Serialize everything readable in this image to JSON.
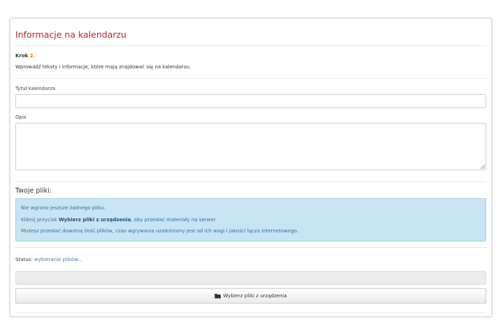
{
  "panel": {
    "title": "Informacje na kalendarzu",
    "step_label": "Krok",
    "step_number": "2.",
    "instruction": "Wprowadź teksty i informacje, które mają znajdować się na kalendarzu."
  },
  "form": {
    "title_label": "Tytuł kalendarza",
    "title_value": "",
    "description_label": "Opis",
    "description_value": ""
  },
  "files": {
    "heading": "Twoje pliki:",
    "info_line1": "Nie wgrano jeszcze żadnego pliku.",
    "info_line2_pre": "Kliknij przycisk",
    "info_line2_bold": "Wybierz pliki z urządzenia",
    "info_line2_post": ", aby przesłać materiały na serwer.",
    "info_line3": "Możesz przesłać dowolną ilość plików, czas wgrywania uzależniony jest od ich wagi i jakości łącza internetowego."
  },
  "status": {
    "label": "Status:",
    "value": "wybieranie plików...",
    "progress_percent": 0
  },
  "upload_button": {
    "label": "Wybierz pliki z urządzenia",
    "icon": "folder-open-icon"
  },
  "colors": {
    "title": "#c21f1f",
    "step_number": "#e07a1a",
    "info_bg": "#c6e4f4",
    "info_text": "#3a6f99",
    "status_link": "#3e7bb6"
  }
}
